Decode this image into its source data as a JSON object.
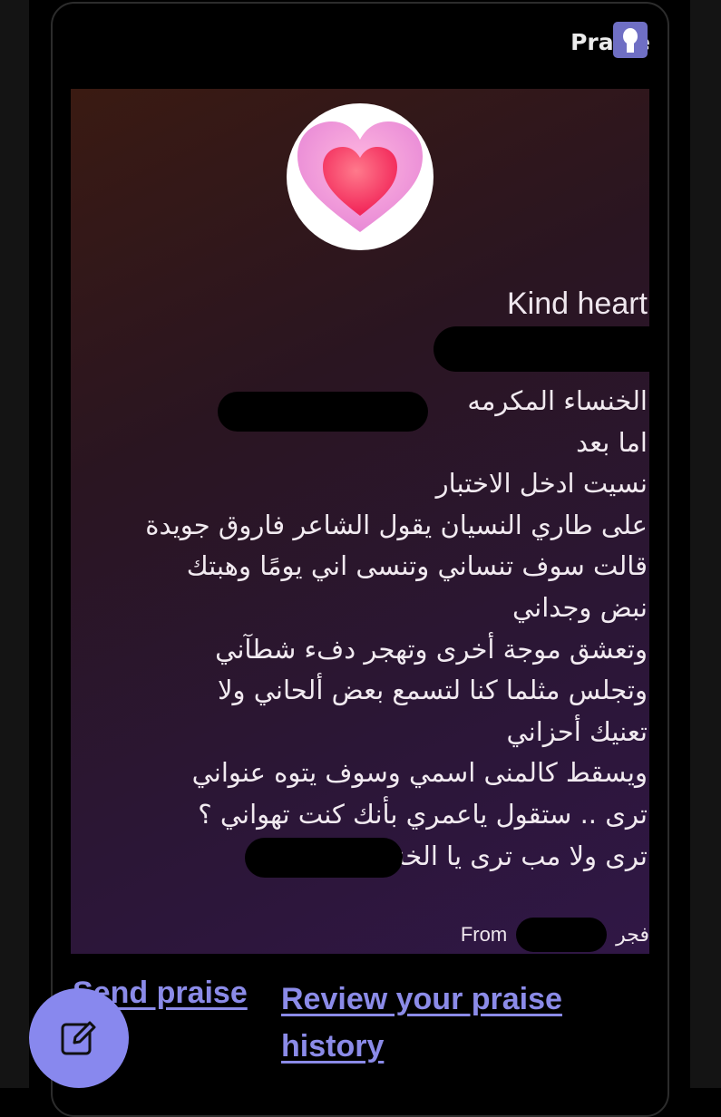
{
  "header": {
    "title": "Praise",
    "badge_icon": "award-icon"
  },
  "praise": {
    "badge_name": "Kind heart",
    "message_lines": [
      "الخنساء المكرمه",
      "اما بعد",
      "نسيت ادخل الاختبار",
      "على طاري النسيان يقول الشاعر فاروق جويدة",
      "قالت سوف تنساني وتنسى اني يومًا وهبتك",
      "نبض وجداني",
      "وتعشق موجة أخرى وتهجر دفء شطآني",
      "وتجلس مثلما كنا لتسمع بعض ألحاني ولا",
      "تعنيك أحزاني",
      "ويسقط كالمنى اسمي وسوف يتوه عنواني",
      "ترى .. ستقول ياعمري بأنك كنت تهواني ؟",
      "ترى ولا مب ترى يا الخنساء"
    ],
    "from_label": "From",
    "from_name": "فجر"
  },
  "links": {
    "send_praise": "Send praise",
    "review_history": "Review your praise history"
  },
  "fab": {
    "icon": "edit-icon"
  },
  "colors": {
    "accent": "#8b8be8",
    "fab": "#8888ee",
    "badge": "#6f6fc4"
  }
}
